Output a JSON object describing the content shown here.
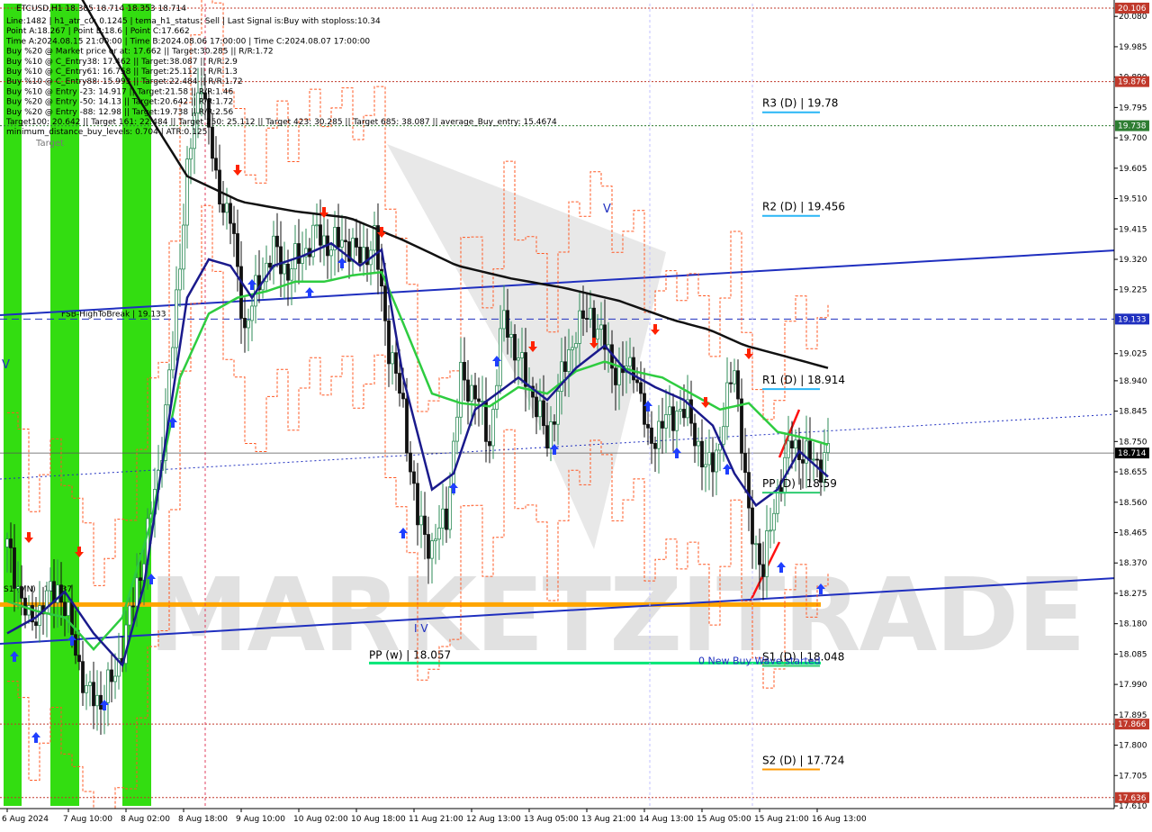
{
  "chart_data": {
    "type": "candlestick",
    "symbol_line": "ETCUSD,H1  18.385 18.714 18.353 18.714",
    "info_lines": [
      "Line:1482 | h1_atr_c0: 0.1245 | tema_h1_status: Sell | Last Signal is:Buy with stoploss:10.34",
      "Point A:18.267 | Point B:18.6 | Point C:17.662",
      "Time A:2024.08.15 21:00:00 | Time B:2024.08.06 17:00:00 | Time C:2024.08.07 17:00:00",
      "Buy %20 @ Market price or at: 17.662 || Target:30.285 || R/R:1.72",
      "Buy %10 @ C_Entry38: 17.462 || Target:38.087 || R/R:2.9",
      "Buy %10 @ C_Entry61: 16.758 || Target:25.112 || R/R:1.3",
      "Buy %10 @ C_Entry88: 15.993 || Target:22.484 || R/R:1.72",
      "Buy %10 @ Entry -23: 14.917 || Target:21.58 || R/R:1.46",
      "Buy %20 @ Entry -50: 14.13 || Target:20.642 || R/R:1.72",
      "Buy %20 @ Entry -88: 12.98 || Target:19.738 || R/R:2.56",
      "Target100: 20.642 || Target 161: 22.484 || Target 250: 25.112 || Target 423: 30.285 || Target 685: 38.087 || average_Buy_entry: 15.4674",
      "minimum_distance_buy_levels: 0.704 | ATR:0.125"
    ],
    "ylim": [
      17.61,
      20.12
    ],
    "y_ticks": [
      "20.080",
      "19.985",
      "19.890",
      "19.795",
      "19.700",
      "19.605",
      "19.510",
      "19.415",
      "19.320",
      "19.225",
      "19.025",
      "18.940",
      "18.845",
      "18.750",
      "18.655",
      "18.560",
      "18.465",
      "18.370",
      "18.275",
      "18.180",
      "18.085",
      "17.990",
      "17.895",
      "17.800",
      "17.705",
      "17.610"
    ],
    "x_labels": [
      {
        "text": "6 Aug 2024",
        "bar": 0
      },
      {
        "text": "7 Aug 10:00",
        "bar": 17
      },
      {
        "text": "8 Aug 02:00",
        "bar": 33
      },
      {
        "text": "8 Aug 18:00",
        "bar": 49
      },
      {
        "text": "9 Aug 10:00",
        "bar": 65
      },
      {
        "text": "10 Aug 02:00",
        "bar": 81
      },
      {
        "text": "10 Aug 18:00",
        "bar": 97
      },
      {
        "text": "11 Aug 21:00",
        "bar": 113
      },
      {
        "text": "12 Aug 13:00",
        "bar": 129
      },
      {
        "text": "13 Aug 05:00",
        "bar": 145
      },
      {
        "text": "13 Aug 21:00",
        "bar": 161
      },
      {
        "text": "14 Aug 13:00",
        "bar": 177
      },
      {
        "text": "15 Aug 05:00",
        "bar": 193
      },
      {
        "text": "15 Aug 21:00",
        "bar": 209
      },
      {
        "text": "16 Aug 13:00",
        "bar": 225
      }
    ],
    "level_lines": [
      {
        "value": 20.106,
        "badge": "20.106",
        "color": "#c0392b",
        "style": "dotted"
      },
      {
        "value": 19.876,
        "badge": "19.876",
        "color": "#c0392b",
        "style": "dotted"
      },
      {
        "value": 19.738,
        "badge": "19.738",
        "color": "#2e7d32",
        "style": "dotted"
      },
      {
        "value": 19.133,
        "badge": "19.133",
        "color": "#1f2fbf",
        "style": "dashed",
        "label": "FSB-HighToBreak | 19.133"
      },
      {
        "value": 18.714,
        "badge": "18.714",
        "color": "#555555",
        "style": "solid",
        "badge_bg": "#000000"
      },
      {
        "value": 17.866,
        "badge": "17.866",
        "color": "#c0392b",
        "style": "dotted"
      },
      {
        "value": 17.636,
        "badge": "17.636",
        "color": "#c0392b",
        "style": "dotted"
      }
    ],
    "pivot_levels": [
      {
        "label": "R3 (D) | 19.78",
        "value": 19.78,
        "color": "#29b6f6"
      },
      {
        "label": "R2 (D) | 19.456",
        "value": 19.456,
        "color": "#29b6f6"
      },
      {
        "label": "R1 (D) | 18.914",
        "value": 18.914,
        "color": "#29b6f6"
      },
      {
        "label": "PP (D) | 18.59",
        "value": 18.59,
        "color": "#2ecc71"
      },
      {
        "label": "S1 (D) | 18.048",
        "value": 18.048,
        "color": "#2ecc71"
      },
      {
        "label": "S2 (D) | 17.724",
        "value": 17.724,
        "color": "#ff9800"
      }
    ],
    "weekly_pivot": {
      "label": "PP (w) | 18.057",
      "value": 18.057,
      "color": "#00e676"
    },
    "orange_level": {
      "value": 18.24,
      "color": "#ffa500"
    },
    "annotation": "0 New Buy Wave started",
    "s1_left_label": "S1 (MN) | 18.237",
    "target_label": "Target",
    "wave_labels": [
      "V",
      "V",
      "I V"
    ],
    "watermark": "MARKETZITRADE",
    "colors": {
      "bull": "#2e8b57",
      "bear": "#111111",
      "ma_black": "#111111",
      "ma_green": "#2ecc40",
      "ma_navy": "#1a1a8c",
      "channel": "#1f2fbf",
      "atr": "#ff5722",
      "green_zone": "#33dd11",
      "buy_arrow": "#1f3fff",
      "sell_arrow": "#ff2200"
    },
    "price_keypoints": [
      [
        0,
        18.42
      ],
      [
        6,
        18.18
      ],
      [
        10,
        18.24
      ],
      [
        14,
        18.3
      ],
      [
        18,
        18.15
      ],
      [
        22,
        17.96
      ],
      [
        26,
        17.94
      ],
      [
        30,
        18.02
      ],
      [
        34,
        18.2
      ],
      [
        38,
        18.4
      ],
      [
        42,
        18.65
      ],
      [
        46,
        19.05
      ],
      [
        50,
        19.6
      ],
      [
        54,
        19.9
      ],
      [
        58,
        19.55
      ],
      [
        62,
        19.45
      ],
      [
        66,
        19.1
      ],
      [
        70,
        19.25
      ],
      [
        74,
        19.35
      ],
      [
        78,
        19.28
      ],
      [
        82,
        19.34
      ],
      [
        86,
        19.4
      ],
      [
        90,
        19.36
      ],
      [
        94,
        19.38
      ],
      [
        98,
        19.32
      ],
      [
        102,
        19.38
      ],
      [
        106,
        19.05
      ],
      [
        110,
        18.85
      ],
      [
        114,
        18.5
      ],
      [
        118,
        18.42
      ],
      [
        122,
        18.52
      ],
      [
        126,
        18.95
      ],
      [
        130,
        18.9
      ],
      [
        134,
        18.75
      ],
      [
        138,
        19.15
      ],
      [
        142,
        19.0
      ],
      [
        146,
        18.9
      ],
      [
        150,
        18.75
      ],
      [
        154,
        18.95
      ],
      [
        158,
        19.1
      ],
      [
        162,
        19.15
      ],
      [
        166,
        19.05
      ],
      [
        170,
        18.95
      ],
      [
        174,
        19.0
      ],
      [
        178,
        18.75
      ],
      [
        182,
        18.8
      ],
      [
        186,
        18.85
      ],
      [
        190,
        18.82
      ],
      [
        194,
        18.65
      ],
      [
        198,
        18.75
      ],
      [
        202,
        19.0
      ],
      [
        206,
        18.5
      ],
      [
        210,
        18.35
      ],
      [
        214,
        18.6
      ],
      [
        218,
        18.75
      ],
      [
        222,
        18.7
      ],
      [
        226,
        18.68
      ],
      [
        228,
        18.714
      ]
    ],
    "ema200_keypoints": [
      [
        0,
        20.25
      ],
      [
        20,
        20.15
      ],
      [
        35,
        19.85
      ],
      [
        50,
        19.58
      ],
      [
        65,
        19.5
      ],
      [
        80,
        19.47
      ],
      [
        95,
        19.45
      ],
      [
        110,
        19.38
      ],
      [
        125,
        19.3
      ],
      [
        140,
        19.26
      ],
      [
        155,
        19.23
      ],
      [
        170,
        19.19
      ],
      [
        185,
        19.13
      ],
      [
        195,
        19.1
      ],
      [
        205,
        19.05
      ],
      [
        215,
        19.02
      ],
      [
        228,
        18.98
      ]
    ],
    "ema50_keypoints": [
      [
        0,
        18.25
      ],
      [
        8,
        18.22
      ],
      [
        16,
        18.2
      ],
      [
        24,
        18.1
      ],
      [
        32,
        18.2
      ],
      [
        40,
        18.5
      ],
      [
        48,
        18.95
      ],
      [
        56,
        19.15
      ],
      [
        64,
        19.2
      ],
      [
        72,
        19.22
      ],
      [
        80,
        19.25
      ],
      [
        88,
        19.25
      ],
      [
        96,
        19.27
      ],
      [
        104,
        19.28
      ],
      [
        110,
        19.12
      ],
      [
        118,
        18.9
      ],
      [
        126,
        18.87
      ],
      [
        134,
        18.86
      ],
      [
        142,
        18.92
      ],
      [
        150,
        18.9
      ],
      [
        158,
        18.97
      ],
      [
        166,
        19.0
      ],
      [
        174,
        18.97
      ],
      [
        182,
        18.95
      ],
      [
        190,
        18.9
      ],
      [
        198,
        18.85
      ],
      [
        206,
        18.87
      ],
      [
        214,
        18.78
      ],
      [
        222,
        18.76
      ],
      [
        228,
        18.74
      ]
    ],
    "ema20_keypoints": [
      [
        0,
        18.15
      ],
      [
        8,
        18.2
      ],
      [
        16,
        18.28
      ],
      [
        24,
        18.15
      ],
      [
        32,
        18.05
      ],
      [
        38,
        18.3
      ],
      [
        44,
        18.75
      ],
      [
        50,
        19.2
      ],
      [
        56,
        19.32
      ],
      [
        62,
        19.3
      ],
      [
        68,
        19.2
      ],
      [
        74,
        19.3
      ],
      [
        82,
        19.33
      ],
      [
        90,
        19.37
      ],
      [
        98,
        19.3
      ],
      [
        104,
        19.35
      ],
      [
        110,
        18.95
      ],
      [
        118,
        18.6
      ],
      [
        124,
        18.65
      ],
      [
        130,
        18.85
      ],
      [
        136,
        18.9
      ],
      [
        142,
        18.95
      ],
      [
        150,
        18.88
      ],
      [
        158,
        18.98
      ],
      [
        166,
        19.05
      ],
      [
        172,
        18.97
      ],
      [
        180,
        18.92
      ],
      [
        188,
        18.88
      ],
      [
        196,
        18.8
      ],
      [
        202,
        18.65
      ],
      [
        208,
        18.55
      ],
      [
        214,
        18.6
      ],
      [
        220,
        18.72
      ],
      [
        228,
        18.64
      ]
    ]
  }
}
